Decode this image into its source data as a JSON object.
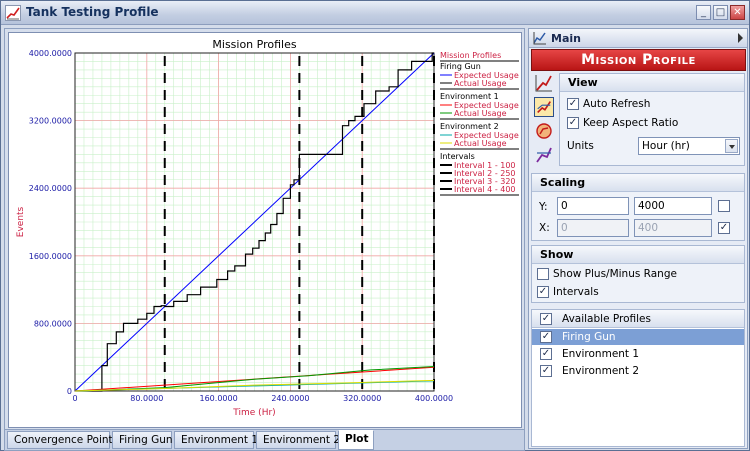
{
  "window": {
    "title": "Tank Testing Profile"
  },
  "tabs": [
    "Convergence Points",
    "Firing Gun",
    "Environment 1",
    "Environment 2",
    "Plot"
  ],
  "chart_data": {
    "type": "line",
    "title": "Mission Profiles",
    "xlabel": "Time (Hr)",
    "ylabel": "Events",
    "xlim": [
      0,
      400
    ],
    "ylim": [
      0,
      4000
    ],
    "xticks": [
      "0",
      "80.0000",
      "160.0000",
      "240.0000",
      "320.0000",
      "400.0000"
    ],
    "yticks": [
      "0",
      "800.0000",
      "1600.0000",
      "2400.0000",
      "3200.0000",
      "4000.0000"
    ],
    "legend": {
      "title": "Mission Profiles",
      "groups": [
        {
          "name": "Firing Gun",
          "items": [
            "Expected Usage",
            "Actual Usage"
          ]
        },
        {
          "name": "Environment 1",
          "items": [
            "Expected Usage",
            "Actual Usage"
          ]
        },
        {
          "name": "Environment 2",
          "items": [
            "Expected Usage",
            "Actual Usage"
          ]
        },
        {
          "name": "Intervals",
          "items": [
            "Interval 1 - 100",
            "Interval 2 - 250",
            "Interval 3 - 320",
            "Interval 4 - 400"
          ]
        }
      ]
    },
    "series": [
      {
        "name": "Firing Gun Expected Usage",
        "color": "#0000ff",
        "x": [
          0,
          400
        ],
        "y": [
          0,
          4000
        ]
      },
      {
        "name": "Firing Gun Actual Usage",
        "color": "#000000",
        "x": [
          0,
          30,
          30,
          36,
          36,
          46,
          46,
          54,
          54,
          70,
          70,
          80,
          80,
          88,
          88,
          96,
          96,
          100,
          100,
          110,
          110,
          125,
          125,
          140,
          140,
          158,
          158,
          170,
          170,
          178,
          178,
          190,
          190,
          198,
          198,
          205,
          205,
          212,
          212,
          218,
          218,
          225,
          225,
          232,
          232,
          240,
          240,
          244,
          244,
          250,
          250,
          298,
          298,
          305,
          305,
          312,
          312,
          322,
          322,
          335,
          335,
          350,
          350,
          360,
          360,
          375,
          375,
          398,
          398,
          400
        ],
        "y": [
          0,
          0,
          300,
          300,
          560,
          560,
          700,
          700,
          800,
          800,
          850,
          850,
          920,
          920,
          1000,
          1000,
          1010,
          1010,
          1000,
          1000,
          1060,
          1060,
          1140,
          1140,
          1230,
          1230,
          1320,
          1320,
          1420,
          1420,
          1480,
          1480,
          1620,
          1620,
          1690,
          1690,
          1780,
          1780,
          1870,
          1870,
          1970,
          1970,
          2100,
          2100,
          2280,
          2280,
          2440,
          2440,
          2500,
          2500,
          2800,
          2800,
          3140,
          3140,
          3200,
          3200,
          3250,
          3250,
          3400,
          3400,
          3550,
          3550,
          3600,
          3600,
          3800,
          3800,
          3900,
          3900,
          4000,
          4000
        ]
      },
      {
        "name": "Environment 1 Expected Usage",
        "color": "#ff0000",
        "x": [
          0,
          400
        ],
        "y": [
          0,
          280
        ]
      },
      {
        "name": "Environment 1 Actual Usage",
        "color": "#009900",
        "x": [
          0,
          30,
          100,
          200,
          260,
          330,
          400
        ],
        "y": [
          0,
          10,
          40,
          140,
          180,
          250,
          290
        ]
      },
      {
        "name": "Environment 2 Expected Usage",
        "color": "#00aaaa",
        "x": [
          0,
          400
        ],
        "y": [
          0,
          120
        ]
      },
      {
        "name": "Environment 2 Actual Usage",
        "color": "#dddd00",
        "x": [
          0,
          30,
          100,
          200,
          300,
          400
        ],
        "y": [
          0,
          8,
          30,
          70,
          95,
          125
        ]
      }
    ],
    "intervals": [
      100,
      250,
      320,
      400
    ]
  },
  "right": {
    "header": "Main",
    "banner": "Mission Profile",
    "view": {
      "title": "View",
      "auto_refresh": "Auto Refresh",
      "keep_aspect": "Keep Aspect Ratio",
      "units_label": "Units",
      "units_value": "Hour (hr)"
    },
    "scaling": {
      "title": "Scaling",
      "y_label": "Y:",
      "y_min": "0",
      "y_max": "4000",
      "x_label": "X:",
      "x_min": "0",
      "x_max": "400"
    },
    "show": {
      "title": "Show",
      "plus_minus": "Show Plus/Minus Range",
      "intervals": "Intervals"
    },
    "profiles": {
      "header": "Available Profiles",
      "items": [
        "Firing Gun",
        "Environment 1",
        "Environment 2"
      ]
    }
  }
}
